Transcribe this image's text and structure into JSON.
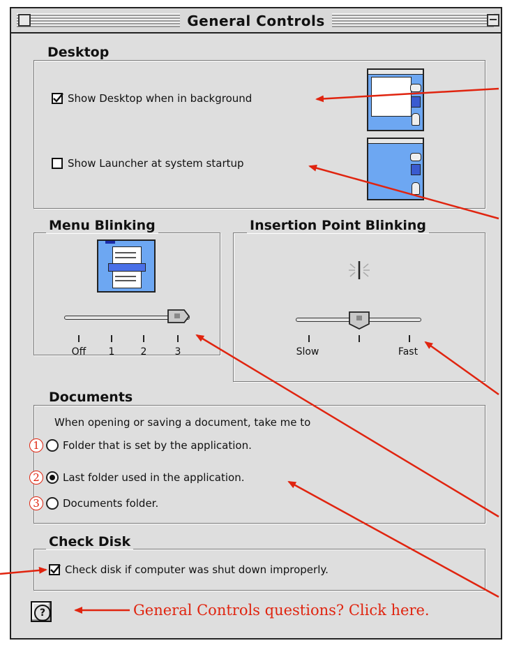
{
  "window": {
    "title": "General Controls"
  },
  "desktop": {
    "group_title": "Desktop",
    "show_desktop_label": "Show Desktop when in background",
    "show_desktop_checked": true,
    "show_launcher_label": "Show Launcher at system startup",
    "show_launcher_checked": false
  },
  "menu_blinking": {
    "group_title": "Menu Blinking",
    "ticks": [
      "Off",
      "1",
      "2",
      "3"
    ],
    "value": "3"
  },
  "insertion_point": {
    "group_title": "Insertion Point Blinking",
    "ticks": [
      "Slow",
      "",
      "Fast"
    ],
    "value_fraction": 0.5
  },
  "documents": {
    "group_title": "Documents",
    "prompt": "When opening or saving a document, take me to",
    "options": [
      {
        "number": "1",
        "label": "Folder that is set by the application.",
        "selected": false
      },
      {
        "number": "2",
        "label": "Last folder used in the application.",
        "selected": true
      },
      {
        "number": "3",
        "label": "Documents folder.",
        "selected": false
      }
    ]
  },
  "check_disk": {
    "group_title": "Check Disk",
    "label": "Check disk if computer was shut down improperly.",
    "checked": true
  },
  "help": {
    "button_glyph": "?",
    "caption": "General Controls questions? Click here."
  },
  "colors": {
    "annotation": "#e0240f",
    "window_bg": "#dedede",
    "thumb_blue": "#6da7f2"
  },
  "icons": [
    "close-box-icon",
    "zoom-box-icon",
    "checkmark-icon",
    "desktop-preview-icon",
    "launcher-preview-icon",
    "menu-blink-icon",
    "insertion-point-icon",
    "help-icon",
    "annotation-arrow-icon"
  ]
}
